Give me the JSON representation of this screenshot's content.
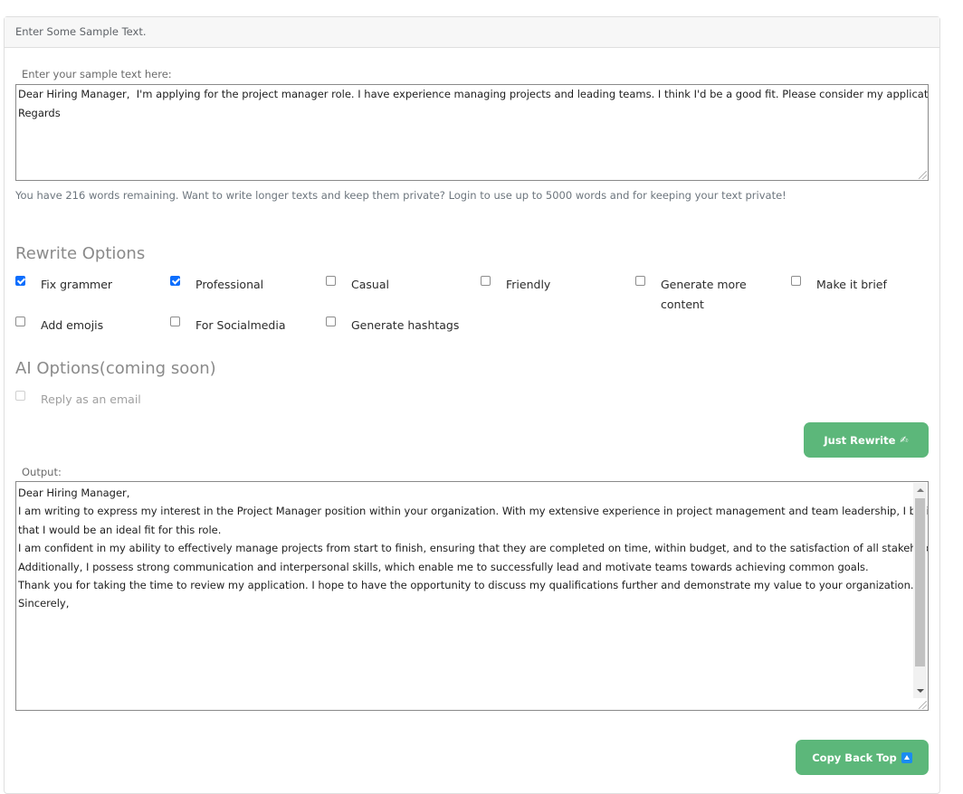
{
  "card": {
    "header": "Enter Some Sample Text."
  },
  "input": {
    "label": "Enter your sample text here:",
    "lines": [
      "Dear Hiring Manager,  I'm applying for the project manager role. I have experience managing projects and leading teams. I think I'd be a good fit. Please consider my application.",
      "Regards"
    ],
    "help": "You have 216 words remaining. Want to write longer texts and keep them private? Login to use up to 5000 words and for keeping your text private!"
  },
  "rewrite_options": {
    "title": "Rewrite Options",
    "items": [
      {
        "label": "Fix grammer",
        "checked": true
      },
      {
        "label": "Professional",
        "checked": true
      },
      {
        "label": "Casual",
        "checked": false
      },
      {
        "label": "Friendly",
        "checked": false
      },
      {
        "label": "Generate more content",
        "checked": false
      },
      {
        "label": "Make it brief",
        "checked": false
      },
      {
        "label": "Add emojis",
        "checked": false
      },
      {
        "label": "For Socialmedia",
        "checked": false
      },
      {
        "label": "Generate hashtags",
        "checked": false
      }
    ]
  },
  "ai_options": {
    "title": "AI Options(coming soon)",
    "items": [
      {
        "label": "Reply as an email",
        "checked": false,
        "disabled": true
      }
    ]
  },
  "buttons": {
    "rewrite": "Just Rewrite",
    "rewrite_icon": "✍",
    "copy": "Copy Back Top"
  },
  "output": {
    "label": "Output:",
    "lines": [
      "Dear Hiring Manager,",
      "",
      "I am writing to express my interest in the Project Manager position within your organization. With my extensive experience in project management and team leadership, I believe",
      "that I would be an ideal fit for this role.",
      "",
      "I am confident in my ability to effectively manage projects from start to finish, ensuring that they are completed on time, within budget, and to the satisfaction of all stakeholders.",
      "Additionally, I possess strong communication and interpersonal skills, which enable me to successfully lead and motivate teams towards achieving common goals.",
      "",
      "Thank you for taking the time to review my application. I hope to have the opportunity to discuss my qualifications further and demonstrate my value to your organization.",
      "",
      "Sincerely,"
    ]
  },
  "colors": {
    "button_green": "#5cb77a",
    "checkbox_blue": "#0d6efd",
    "icon_blue": "#1a8cf0"
  }
}
